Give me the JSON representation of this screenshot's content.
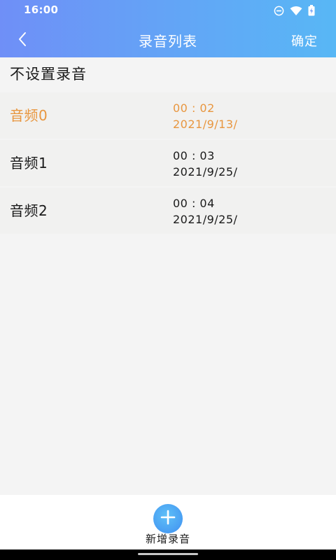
{
  "status_bar": {
    "time": "16:00",
    "icons": [
      "do-not-disturb-icon",
      "wifi-icon",
      "battery-icon"
    ]
  },
  "app_bar": {
    "back_icon": "chevron-left-icon",
    "title": "录音列表",
    "confirm_label": "确定"
  },
  "no_record_option": "不设置录音",
  "recordings": [
    {
      "name": "音频0",
      "duration": "00 : 02",
      "date": "2021/9/13/",
      "selected": true
    },
    {
      "name": "音频1",
      "duration": "00 : 03",
      "date": "2021/9/25/",
      "selected": false
    },
    {
      "name": "音频2",
      "duration": "00 : 04",
      "date": "2021/9/25/",
      "selected": false
    }
  ],
  "bottom_bar": {
    "add_icon": "plus-icon",
    "add_label": "新增录音"
  },
  "colors": {
    "header_gradient_start": "#6f8ff7",
    "header_gradient_end": "#58b7f5",
    "selected_text": "#e8963f",
    "add_button": "#3f8ff1"
  }
}
